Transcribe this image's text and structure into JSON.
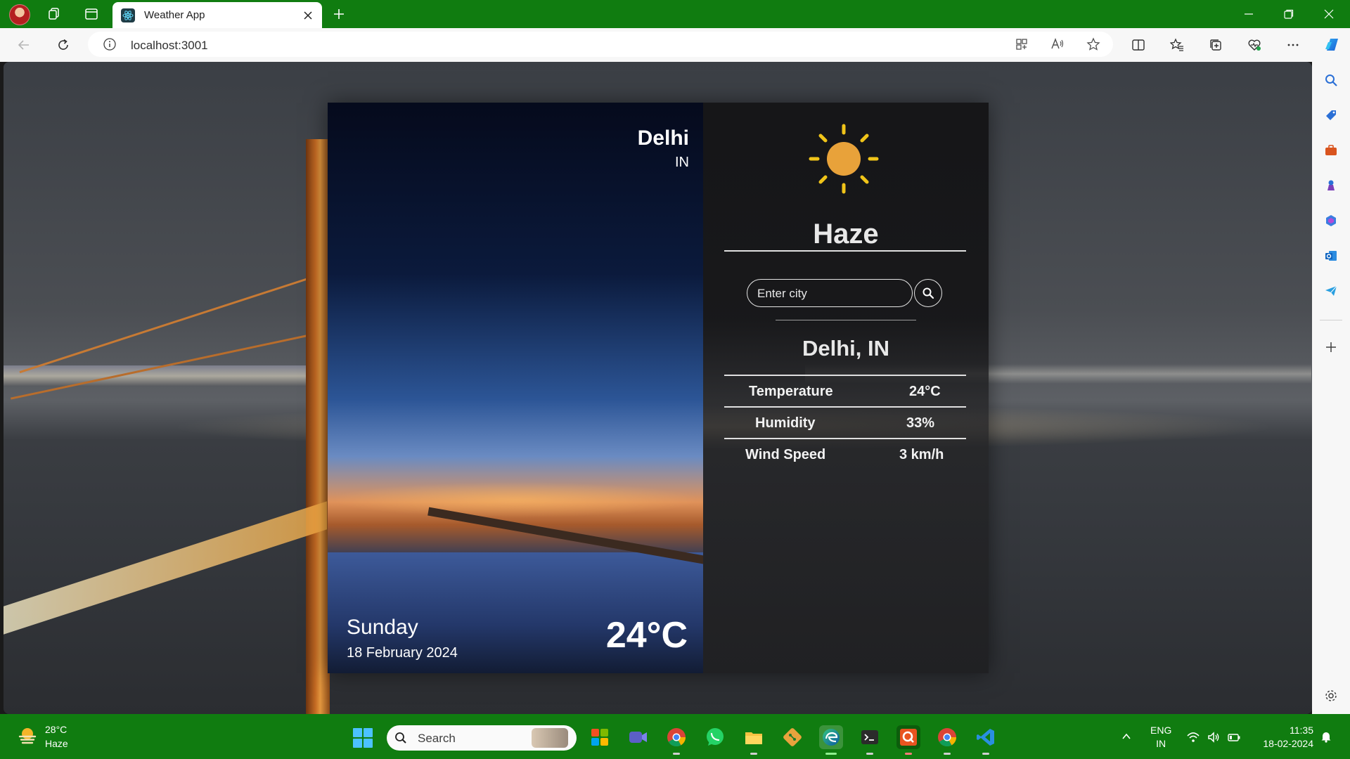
{
  "browser": {
    "tab_title": "Weather App",
    "url": "localhost:3001"
  },
  "weather": {
    "city": "Delhi",
    "country": "IN",
    "day": "Sunday",
    "date": "18 February 2024",
    "temperature_big": "24°C",
    "condition": "Haze",
    "search_placeholder": "Enter city",
    "location": "Delhi, IN",
    "stats": [
      {
        "label": "Temperature",
        "value": "24°C"
      },
      {
        "label": "Humidity",
        "value": "33%"
      },
      {
        "label": "Wind Speed",
        "value": "3 km/h"
      }
    ],
    "sun_color": "#e8a23a"
  },
  "taskbar": {
    "weather_temp": "28°C",
    "weather_condition": "Haze",
    "search_label": "Search",
    "language": "ENG",
    "region": "IN",
    "time": "11:35",
    "date": "18-02-2024",
    "pinned_apps": [
      "copilot-app",
      "teams-meet-app",
      "chrome-app",
      "whatsapp-app",
      "file-explorer-app",
      "git-app",
      "edge-app",
      "terminal-app",
      "qt-app",
      "chrome-profile-app",
      "vscode-app"
    ]
  },
  "colors": {
    "accent_green": "#107c10",
    "windows_blue": "#4cc2ff"
  }
}
